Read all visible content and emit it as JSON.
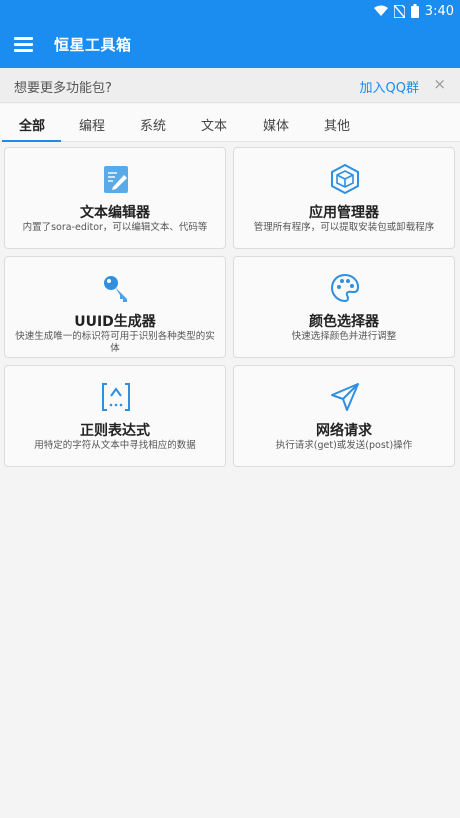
{
  "status_bar": {
    "time": "3:40",
    "icons": [
      "wifi-icon",
      "no-sim-icon",
      "battery-icon"
    ]
  },
  "app_bar": {
    "title": "恒星工具箱",
    "menu_icon": "hamburger-menu-icon"
  },
  "banner": {
    "text": "想要更多功能包?",
    "link": "加入QQ群",
    "close": "×"
  },
  "tabs": [
    {
      "label": "全部",
      "active": true
    },
    {
      "label": "编程",
      "active": false
    },
    {
      "label": "系统",
      "active": false
    },
    {
      "label": "文本",
      "active": false
    },
    {
      "label": "媒体",
      "active": false
    },
    {
      "label": "其他",
      "active": false
    }
  ],
  "tools": [
    {
      "title": "文本编辑器",
      "desc": "内置了sora-editor，可以编辑文本、代码等",
      "icon": "text-editor-icon"
    },
    {
      "title": "应用管理器",
      "desc": "管理所有程序，可以提取安装包或卸载程序",
      "icon": "app-manager-cube-icon"
    },
    {
      "title": "UUID生成器",
      "desc": "快速生成唯一的标识符可用于识别各种类型的实体",
      "icon": "uuid-key-icon"
    },
    {
      "title": "颜色选择器",
      "desc": "快速选择颜色并进行调整",
      "icon": "color-palette-icon"
    },
    {
      "title": "正则表达式",
      "desc": "用特定的字符从文本中寻找相应的数据",
      "icon": "regex-icon"
    },
    {
      "title": "网络请求",
      "desc": "执行请求(get)或发送(post)操作",
      "icon": "network-send-icon"
    }
  ],
  "colors": {
    "primary": "#1b8cf0",
    "icon_blue": "#4aa3e8",
    "background": "#f4f4f4"
  }
}
